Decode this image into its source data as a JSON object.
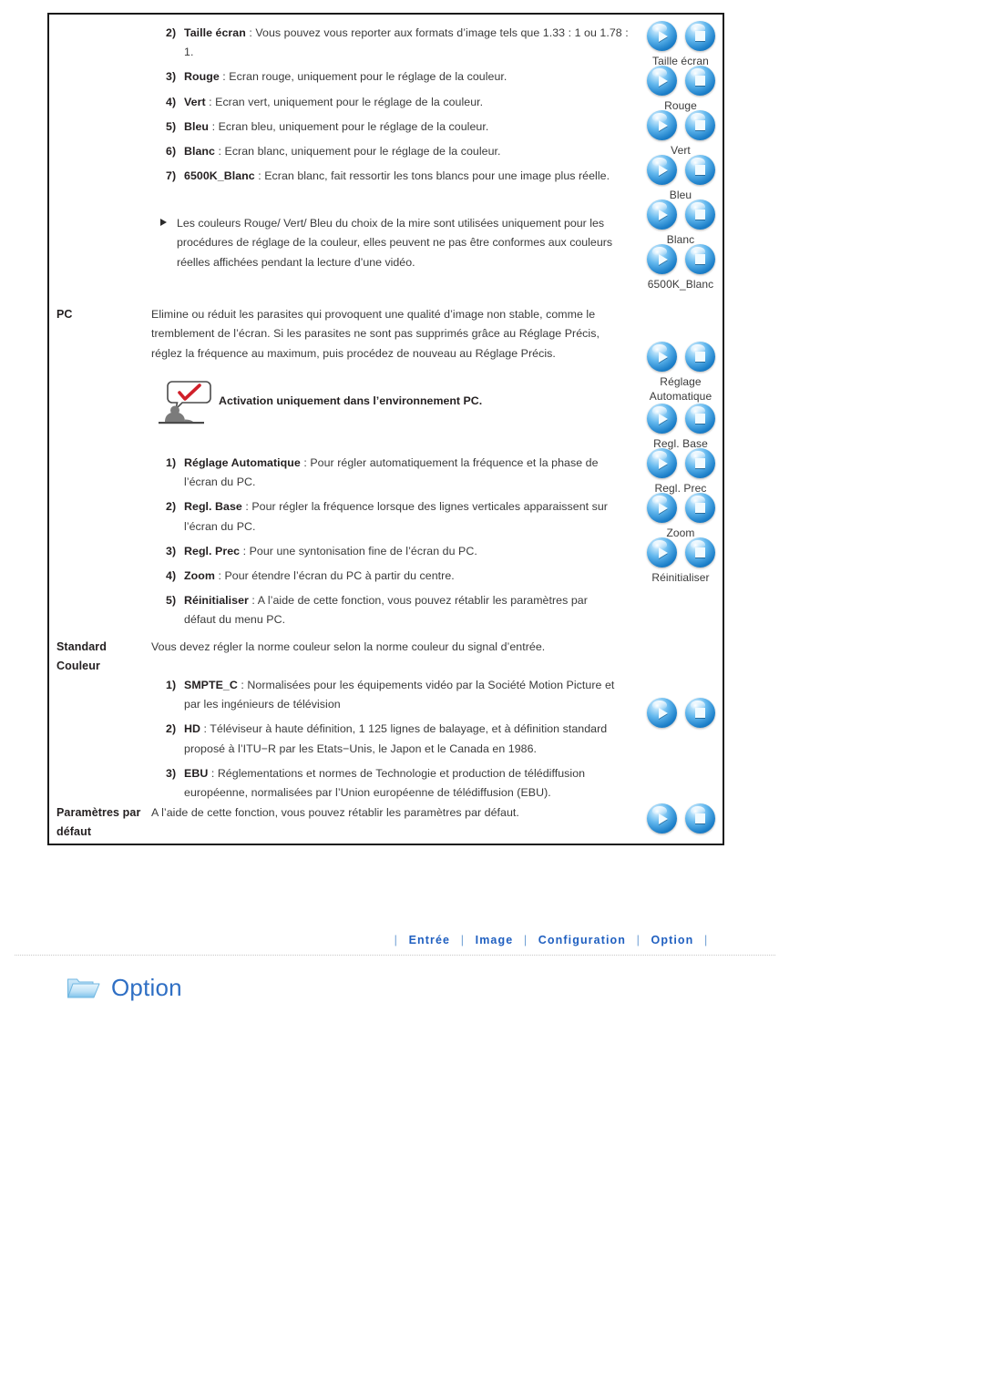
{
  "manual": {
    "image_section": {
      "items": [
        {
          "num": "2)",
          "term": "Taille écran",
          "sep": ":",
          "text": "Vous pouvez vous reporter aux formats d’image tels que 1.33 : 1 ou 1.78 : 1."
        },
        {
          "num": "3)",
          "term": "Rouge",
          "sep": ":",
          "text": "Ecran rouge, uniquement pour le réglage de la couleur."
        },
        {
          "num": "4)",
          "term": "Vert",
          "sep": ":",
          "text": "Ecran vert, uniquement pour le réglage de la couleur."
        },
        {
          "num": "5)",
          "term": "Bleu",
          "sep": ":",
          "text": "Ecran bleu, uniquement pour le réglage de la couleur."
        },
        {
          "num": "6)",
          "term": "Blanc",
          "sep": ":",
          "text": "Ecran blanc, uniquement pour le réglage de la couleur."
        },
        {
          "num": "7)",
          "term": "6500K_Blanc",
          "sep": ":",
          "text": "Ecran blanc, fait ressortir les tons blancs pour une image plus réelle."
        }
      ],
      "note": "Les couleurs Rouge/ Vert/ Bleu du choix de la mire sont utilisées uniquement pour les procédures de réglage de la couleur, elles peuvent ne pas être conformes aux couleurs réelles affichées pendant la lecture d’une vidéo."
    },
    "pc_section": {
      "label": "PC",
      "intro": "Elimine ou réduit les parasites qui provoquent une qualité d’image non stable, comme le tremblement de l’écran. Si les parasites ne sont pas supprimés grâce au Réglage Précis, réglez la fréquence au maximum, puis procédez de nouveau au Réglage Précis.",
      "tip": "Activation uniquement dans l’environnement PC.",
      "items": [
        {
          "num": "1)",
          "term": "Réglage Automatique",
          "sep": ":",
          "text": "Pour régler automatiquement la fréquence et la phase de l’écran du PC."
        },
        {
          "num": "2)",
          "term": "Regl. Base",
          "sep": ":",
          "text": "Pour régler la fréquence lorsque des lignes verticales apparaissent sur l’écran du PC."
        },
        {
          "num": "3)",
          "term": "Regl. Prec",
          "sep": ":",
          "text": "Pour une syntonisation fine de l’écran du PC."
        },
        {
          "num": "4)",
          "term": "Zoom",
          "sep": ":",
          "text": "Pour étendre l’écran du PC à partir du centre."
        },
        {
          "num": "5)",
          "term": "Réinitialiser",
          "sep": ":",
          "text": "A l’aide de cette fonction, vous pouvez rétablir les paramètres par défaut du menu PC."
        }
      ]
    },
    "standard_section": {
      "label_line1": "Standard",
      "label_line2": "Couleur",
      "intro": "Vous devez régler la norme couleur selon la norme couleur du signal d’entrée.",
      "items": [
        {
          "num": "1)",
          "term": "SMPTE_C",
          "sep": ":",
          "text": "Normalisées pour les équipements vidéo par la Société Motion Picture et par les ingénieurs de télévision"
        },
        {
          "num": "2)",
          "term": "HD",
          "sep": ":",
          "text": "Téléviseur à haute définition, 1 125 lignes de balayage, et à définition standard proposé à l’ITU−R par les Etats−Unis, le Japon et le Canada en 1986."
        },
        {
          "num": "3)",
          "term": "EBU",
          "sep": ":",
          "text": "Réglementations et normes de Technologie et production de télédiffusion européenne, normalisées par l’Union européenne de télédiffusion (EBU)."
        }
      ]
    },
    "defaults_section": {
      "label_line1": "Paramètres par",
      "label_line2": "défaut",
      "text": "A l’aide de cette fonction, vous pouvez rétablir les paramètres par défaut."
    }
  },
  "controls": {
    "play_icon": "play-icon",
    "stop_icon": "stop-icon",
    "groups_top": [
      {
        "label": "Taille écran"
      },
      {
        "label": "Rouge"
      },
      {
        "label": "Vert"
      },
      {
        "label": "Bleu"
      },
      {
        "label": "Blanc"
      },
      {
        "label": "6500K_Blanc"
      }
    ],
    "groups_pc": [
      {
        "label": "Réglage\nAutomatique"
      },
      {
        "label": "Regl. Base"
      },
      {
        "label": "Regl. Prec"
      },
      {
        "label": "Zoom"
      },
      {
        "label": "Réinitialiser"
      }
    ],
    "groups_bottom": [
      {
        "label": ""
      },
      {
        "label": ""
      }
    ]
  },
  "footer": {
    "separator": "|",
    "links": [
      {
        "label": "Entrée"
      },
      {
        "label": "Image"
      },
      {
        "label": "Configuration"
      },
      {
        "label": "Option"
      }
    ]
  },
  "option_heading": {
    "icon": "folder-icon",
    "title": "Option"
  },
  "colors": {
    "link_blue": "#1f5fc0",
    "heading_blue": "#2f6fc4",
    "button_blue": "#1c7fc9",
    "check_red": "#d0202a",
    "frame_black": "#1a1a1a"
  }
}
